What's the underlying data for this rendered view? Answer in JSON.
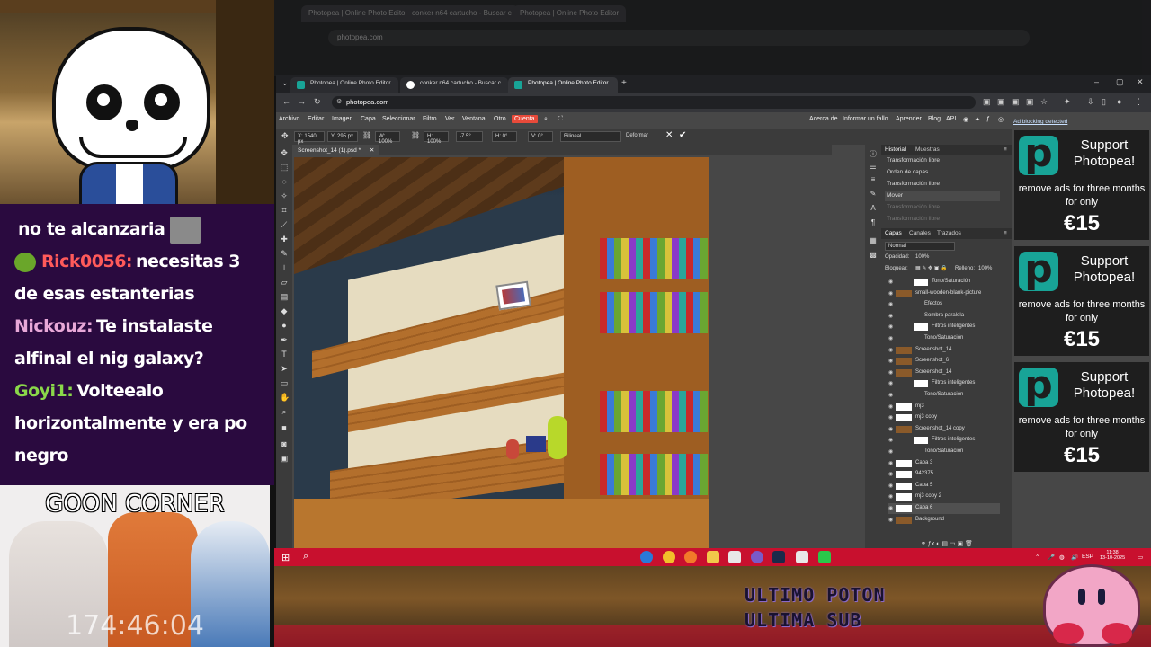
{
  "stream": {
    "chat": [
      {
        "user": "",
        "user_color": "#ffffff",
        "message": "no te alcanzaria"
      },
      {
        "user": "Rick0056:",
        "user_color": "#ff5a5a",
        "message": "necesitas 3 de esas estanterias"
      },
      {
        "user": "Nickouz:",
        "user_color": "#e8a8d8",
        "message": "Te instalaste alfinal el nig galaxy?"
      },
      {
        "user": "Goyi1:",
        "user_color": "#8ad84a",
        "message": "Volteealo horizontalmente y era po negro"
      }
    ],
    "panel_title": "GOON CORNER",
    "timer": "174:46:04",
    "overlay_text_1": "ULTIMO POTON",
    "overlay_text_2": "ULTIMA SUB"
  },
  "browser": {
    "tabs": [
      {
        "label": "Photopea | Online Photo Editor",
        "active": false
      },
      {
        "label": "conker n64 cartucho - Buscar c",
        "active": false
      },
      {
        "label": "Photopea | Online Photo Editor",
        "active": true
      }
    ],
    "url": "photopea.com"
  },
  "photopea": {
    "menu": [
      "Archivo",
      "Editar",
      "Imagen",
      "Capa",
      "Seleccionar",
      "Filtro",
      "Ver",
      "Ventana",
      "Otro"
    ],
    "account": "Cuenta",
    "menu_right": [
      "Acerca de",
      "Informar un fallo",
      "Aprender",
      "Blog",
      "API"
    ],
    "options": {
      "x": "X: 1540 px",
      "y": "Y: 295 px",
      "w": "W: 100%",
      "h": "H: 100%",
      "angle": "-7.5°",
      "hskew": "H: 0°",
      "vskew": "V: 0°",
      "interp": "Bilineal",
      "warp": "Deformar"
    },
    "doc_tab": "Screenshot_14 (1).psd *",
    "history_tabs": [
      "Historial",
      "Muestras"
    ],
    "history": [
      {
        "label": "Transformación libre",
        "state": "normal"
      },
      {
        "label": "Orden de capas",
        "state": "normal"
      },
      {
        "label": "Transformación libre",
        "state": "normal"
      },
      {
        "label": "Mover",
        "state": "selected"
      },
      {
        "label": "Transformación libre",
        "state": "dim"
      },
      {
        "label": "Transformación libre",
        "state": "dim"
      }
    ],
    "layer_tabs": [
      "Capas",
      "Canales",
      "Trazados"
    ],
    "blend_mode": "Normal",
    "opacity_label": "Opacidad:",
    "opacity": "100%",
    "lock_label": "Bloquear:",
    "fill_label": "Relleno:",
    "fill": "100%",
    "layers": [
      {
        "name": "Tono/Saturación",
        "type": "sub2"
      },
      {
        "name": "small-wooden-blank-picture",
        "type": "brown"
      },
      {
        "name": "Efectos",
        "type": "sub"
      },
      {
        "name": "Sombra paralela",
        "type": "sub"
      },
      {
        "name": "Filtros inteligentes",
        "type": "sub2"
      },
      {
        "name": "Tono/Saturación",
        "type": "sub"
      },
      {
        "name": "Screenshot_14",
        "type": "brown"
      },
      {
        "name": "Screenshot_6",
        "type": "brown"
      },
      {
        "name": "Screenshot_14",
        "type": "brown"
      },
      {
        "name": "Filtros inteligentes",
        "type": "sub2"
      },
      {
        "name": "Tono/Saturación",
        "type": "sub"
      },
      {
        "name": "mj3",
        "type": "white"
      },
      {
        "name": "mj3 copy",
        "type": "white"
      },
      {
        "name": "Screenshot_14 copy",
        "type": "brown"
      },
      {
        "name": "Filtros inteligentes",
        "type": "sub2"
      },
      {
        "name": "Tono/Saturación",
        "type": "sub"
      },
      {
        "name": "Capa 3",
        "type": "white"
      },
      {
        "name": "942375",
        "type": "white"
      },
      {
        "name": "Capa 5",
        "type": "white"
      },
      {
        "name": "mj3 copy 2",
        "type": "white"
      },
      {
        "name": "Capa 6",
        "type": "white",
        "selected": true
      },
      {
        "name": "Background",
        "type": "brown"
      }
    ]
  },
  "ads": {
    "blocking_link": "Ad blocking detected",
    "items": [
      {
        "title": "Support Photopea!",
        "text": "remove ads for three months for only",
        "price": "€15"
      },
      {
        "title": "Support Photopea!",
        "text": "remove ads for three months for only",
        "price": "€15"
      },
      {
        "title": "Support Photopea!",
        "text": "remove ads for three months for only",
        "price": "€15"
      }
    ]
  },
  "taskbar": {
    "lang": "ESP",
    "time": "11:38",
    "date": "13-10-2025"
  },
  "colors": {
    "taskbar": "#c8102e",
    "photopea_accent": "#18a497",
    "chat_bg": "#2a0a3f"
  }
}
